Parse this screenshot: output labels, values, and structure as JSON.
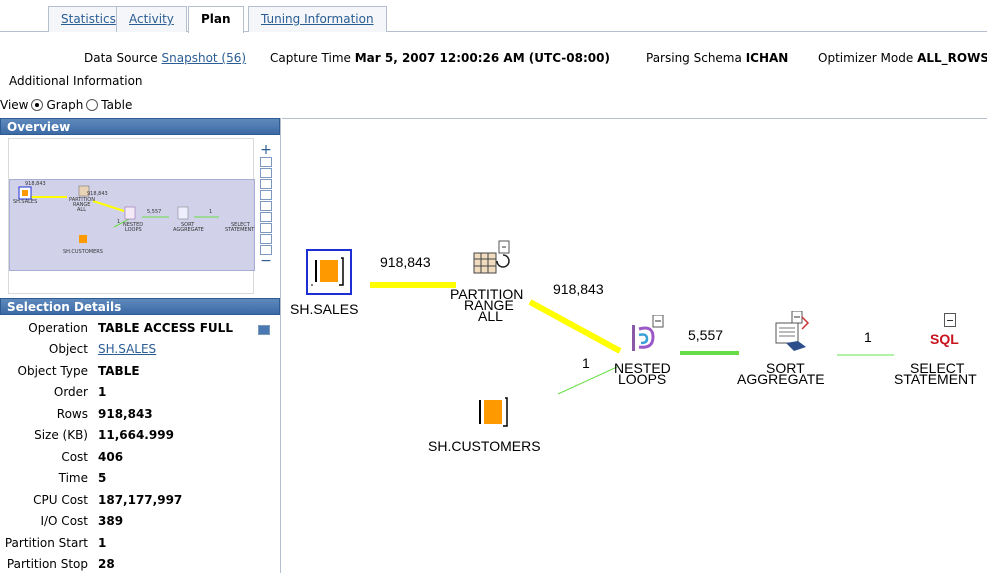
{
  "tabs": [
    {
      "label": "Statistics",
      "active": false
    },
    {
      "label": "Activity",
      "active": false
    },
    {
      "label": "Plan",
      "active": true
    },
    {
      "label": "Tuning Information",
      "active": false
    }
  ],
  "header": {
    "data_source_label": "Data Source",
    "data_source_link": "Snapshot (56)",
    "capture_time_label": "Capture Time",
    "capture_time_value": "Mar 5, 2007 12:00:26 AM (UTC-08:00)",
    "parsing_schema_label": "Parsing Schema",
    "parsing_schema_value": "ICHAN",
    "optimizer_mode_label": "Optimizer Mode",
    "optimizer_mode_value": "ALL_ROWS",
    "additional_info": "Additional Information"
  },
  "view": {
    "label": "View",
    "options": [
      "Graph",
      "Table"
    ],
    "selected": "Graph"
  },
  "overview": {
    "title": "Overview",
    "labels": [
      "918,843",
      "918,843",
      "SH.SALES",
      "PARTITION",
      "RANGE",
      "ALL",
      "5,557",
      "1",
      "1",
      "NESTED",
      "LOOPS",
      "SORT",
      "AGGREGATE",
      "SELECT",
      "STATEMENT",
      "SH.CUSTOMERS"
    ]
  },
  "selection": {
    "title": "Selection Details",
    "rows": [
      {
        "label": "Operation",
        "value": "TABLE ACCESS FULL"
      },
      {
        "label": "Object",
        "value": "SH.SALES"
      },
      {
        "label": "Object Type",
        "value": "TABLE"
      },
      {
        "label": "Order",
        "value": "1"
      },
      {
        "label": "Rows",
        "value": "918,843"
      },
      {
        "label": "Size (KB)",
        "value": "11,664.999"
      },
      {
        "label": "Cost",
        "value": "406"
      },
      {
        "label": "Time",
        "value": "5"
      },
      {
        "label": "CPU Cost",
        "value": "187,177,997"
      },
      {
        "label": "I/O Cost",
        "value": "389"
      },
      {
        "label": "Partition Start",
        "value": "1"
      },
      {
        "label": "Partition Stop",
        "value": "28"
      }
    ]
  },
  "graph": {
    "nodes": {
      "sales": "SH.SALES",
      "partition_1": "PARTITION",
      "partition_2": "RANGE",
      "partition_3": "ALL",
      "nested_1": "NESTED",
      "nested_2": "LOOPS",
      "sort_1": "SORT",
      "sort_2": "AGGREGATE",
      "select_1": "SELECT",
      "select_2": "STATEMENT",
      "customers": "SH.CUSTOMERS",
      "sql_icon_text": "SQL"
    },
    "edges": {
      "sales_to_partition": "918,843",
      "partition_to_nested": "918,843",
      "customers_to_nested": "1",
      "nested_to_sort": "5,557",
      "sort_to_select": "1"
    },
    "colors": {
      "heavy_edge": "#ffff00",
      "light_edge": "#66dd44",
      "selected_border": "#1d2fd0",
      "table_icon": "#ff9900"
    }
  }
}
